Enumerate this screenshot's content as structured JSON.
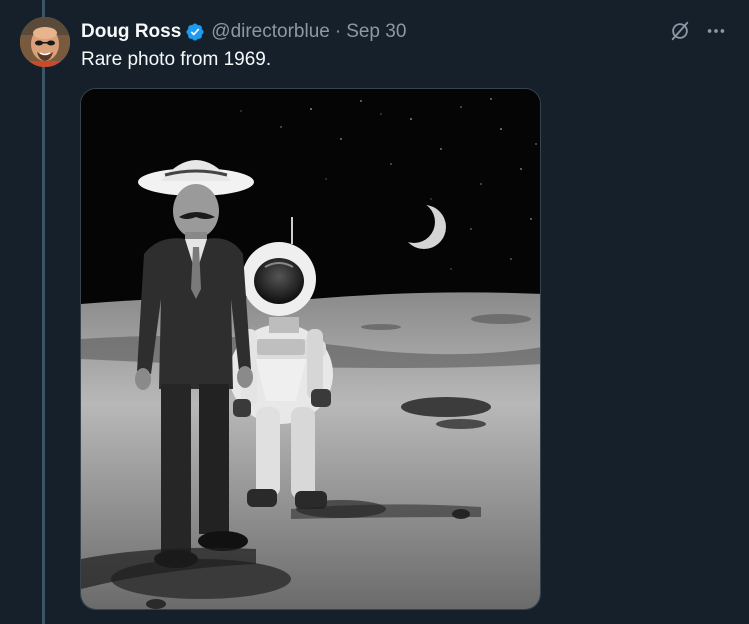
{
  "tweet": {
    "author_name": "Doug Ross",
    "handle": "@directorblue",
    "separator": "·",
    "timestamp": "Sep 30",
    "text": "Rare photo from 1969.",
    "verified": true,
    "avatar_icon": "user-avatar",
    "actions": {
      "grok_icon": "grok-icon",
      "more_icon": "more-options-icon"
    }
  },
  "colors": {
    "background": "#15202b",
    "text": "#f7f9f9",
    "muted": "#8b98a5",
    "verified_blue": "#1d9bf0",
    "thread_line": "#3d5466"
  }
}
